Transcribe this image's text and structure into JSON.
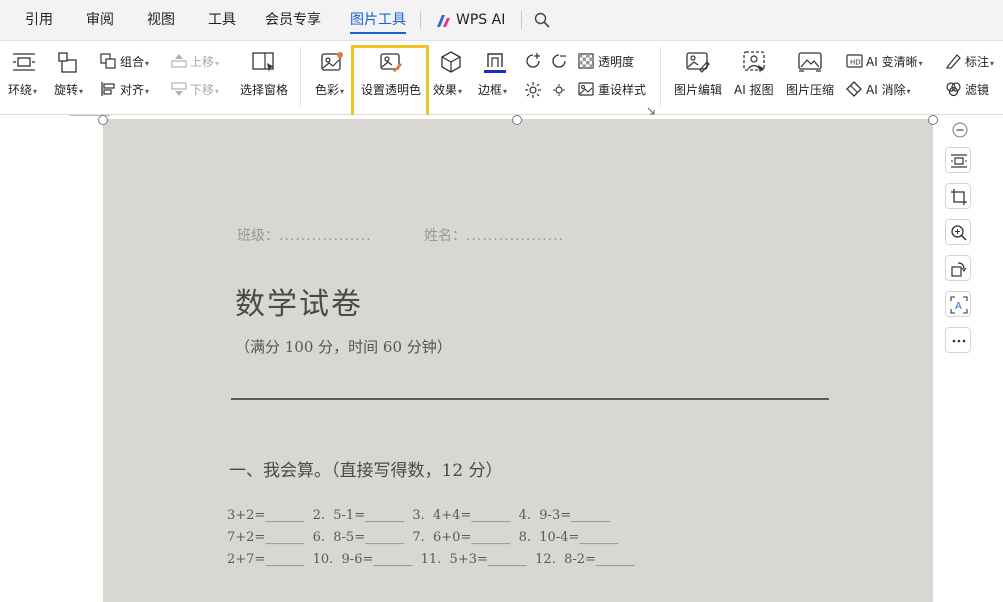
{
  "tabs": [
    "引用",
    "审阅",
    "视图",
    "工具",
    "会员专享",
    "图片工具",
    "WPS AI"
  ],
  "ribbon": {
    "wrap": "环绕",
    "rotate": "旋转",
    "group": "组合",
    "align": "对齐",
    "move_up": "上移",
    "move_down": "下移",
    "selection_pane": "选择窗格",
    "color": "色彩",
    "set_transparent_color": "设置透明色",
    "effects": "效果",
    "border": "边框",
    "transparency": "透明度",
    "reset_style": "重设样式",
    "picture_edit": "图片编辑",
    "ai_cutout": "AI 抠图",
    "picture_compress": "图片压缩",
    "ai_sharpen": "AI 变清晰",
    "ai_erase": "AI 消除",
    "annotate": "标注",
    "filter": "滤镜"
  },
  "document": {
    "class_label": "班级：",
    "name_label": "姓名：",
    "title": "数学试卷",
    "subtitle": "（满分 100 分，时间 60 分钟）",
    "section1": "一、我会算。（直接写得数，12 分）",
    "row1": "3+2=______  2.  5-1=______  3.  4+4=______  4.  9-3=______",
    "row2": "7+2=______  6.  8-5=______  7.  6+0=______  8.  10-4=______",
    "row3": "2+7=______  10.  9-6=______  11.  5+3=______  12.  8-2=______"
  },
  "colors": {
    "accent": "#1a5fd6",
    "highlight": "#f0c420",
    "paper": "#d9d7d2"
  },
  "icons": [
    "search-icon",
    "wrap-icon",
    "rotate-icon",
    "group-icon",
    "align-icon",
    "move-up-icon",
    "move-down-icon",
    "selection-pane-icon",
    "color-icon",
    "set-transparent-color-icon",
    "effects-icon",
    "border-icon",
    "brightness-icon",
    "contrast-icon",
    "transparency-icon",
    "reset-style-icon",
    "picture-edit-icon",
    "ai-cutout-icon",
    "picture-compress-icon",
    "ai-sharpen-icon",
    "ai-erase-icon",
    "annotate-icon",
    "filter-icon",
    "wps-ai-logo-icon",
    "zoom-out-icon",
    "layout-options-icon",
    "crop-icon",
    "zoom-in-icon",
    "rotate-side-icon",
    "ocr-icon",
    "more-icon"
  ]
}
